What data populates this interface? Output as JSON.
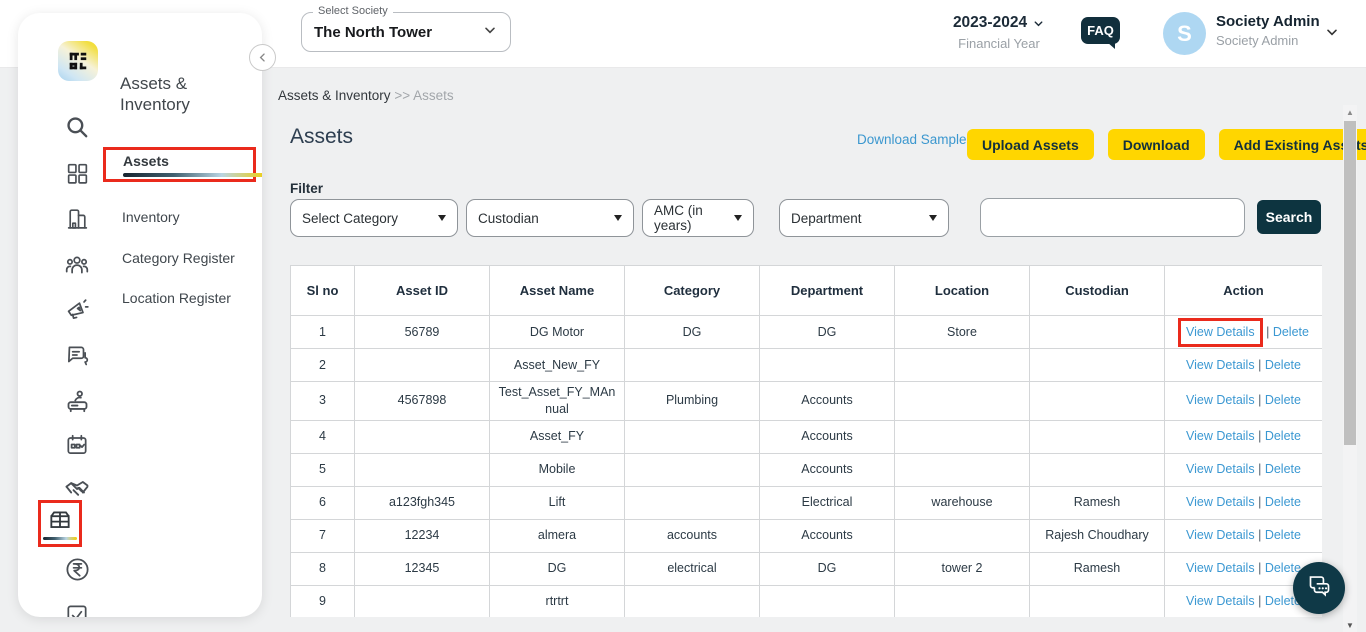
{
  "header": {
    "society_select": {
      "label": "Select Society",
      "value": "The North Tower"
    },
    "financial_year": {
      "value": "2023-2024",
      "label": "Financial Year"
    },
    "faq_label": "FAQ",
    "user": {
      "initial": "S",
      "name": "Society Admin",
      "role": "Society Admin"
    }
  },
  "sidebar": {
    "title": "Assets & Inventory",
    "items": [
      {
        "label": "Assets",
        "active": true
      },
      {
        "label": "Inventory",
        "active": false
      },
      {
        "label": "Category Register",
        "active": false
      },
      {
        "label": "Location Register",
        "active": false
      }
    ],
    "rail_icons": [
      "app-logo",
      "search-icon",
      "dashboard-icon",
      "buildings-icon",
      "community-icon",
      "announcement-icon",
      "discussions-icon",
      "helpdesk-icon",
      "bookings-icon",
      "vendors-icon",
      "assets-icon",
      "payments-icon",
      "polls-icon"
    ]
  },
  "breadcrumb": {
    "parent": "Assets & Inventory",
    "separator": ">>",
    "current": "Assets"
  },
  "page": {
    "title": "Assets",
    "download_sample_label": "Download Sample",
    "action_buttons": [
      "Upload Assets",
      "Download",
      "Add Existing Assets"
    ]
  },
  "filters": {
    "label": "Filter",
    "dropdowns": [
      "Select Category",
      "Custodian",
      "AMC (in years)",
      "Department"
    ],
    "search_input_value": "",
    "search_button_label": "Search"
  },
  "table": {
    "columns": [
      "Sl no",
      "Asset ID",
      "Asset Name",
      "Category",
      "Department",
      "Location",
      "Custodian",
      "Action"
    ],
    "action_labels": {
      "view": "View Details",
      "separator": "|",
      "delete": "Delete"
    },
    "rows": [
      {
        "sl_no": "1",
        "asset_id": "56789",
        "asset_name": "DG Motor",
        "category": "DG",
        "department": "DG",
        "location": "Store",
        "custodian": "",
        "view_highlighted": true
      },
      {
        "sl_no": "2",
        "asset_id": "",
        "asset_name": "Asset_New_FY",
        "category": "",
        "department": "",
        "location": "",
        "custodian": "",
        "view_highlighted": false
      },
      {
        "sl_no": "3",
        "asset_id": "4567898",
        "asset_name": "Test_Asset_FY_MAnnual",
        "category": "Plumbing",
        "department": "Accounts",
        "location": "",
        "custodian": "",
        "view_highlighted": false
      },
      {
        "sl_no": "4",
        "asset_id": "",
        "asset_name": "Asset_FY",
        "category": "",
        "department": "Accounts",
        "location": "",
        "custodian": "",
        "view_highlighted": false
      },
      {
        "sl_no": "5",
        "asset_id": "",
        "asset_name": "Mobile",
        "category": "",
        "department": "Accounts",
        "location": "",
        "custodian": "",
        "view_highlighted": false
      },
      {
        "sl_no": "6",
        "asset_id": "a123fgh345",
        "asset_name": "Lift",
        "category": "",
        "department": "Electrical",
        "location": "warehouse",
        "custodian": "Ramesh",
        "view_highlighted": false
      },
      {
        "sl_no": "7",
        "asset_id": "12234",
        "asset_name": "almera",
        "category": "accounts",
        "department": "Accounts",
        "location": "",
        "custodian": "Rajesh Choudhary",
        "view_highlighted": false
      },
      {
        "sl_no": "8",
        "asset_id": "12345",
        "asset_name": "DG",
        "category": "electrical",
        "department": "DG",
        "location": "tower 2",
        "custodian": "Ramesh",
        "view_highlighted": false
      },
      {
        "sl_no": "9",
        "asset_id": "",
        "asset_name": "rtrtrt",
        "category": "",
        "department": "",
        "location": "",
        "custodian": "",
        "view_highlighted": false
      }
    ]
  },
  "colors": {
    "accent_yellow": "#FFD600",
    "dark_teal": "#0D3440",
    "link_blue": "#3B98D2",
    "annotation_red": "#EA2A1C",
    "avatar_blue": "#AED7F2"
  }
}
